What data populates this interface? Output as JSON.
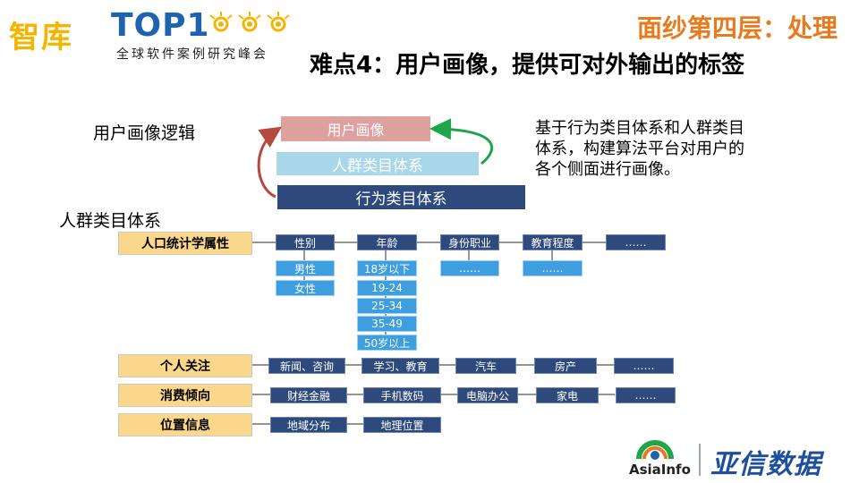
{
  "header": {
    "logo_zhiku": "智库",
    "logo_top": "TOP1",
    "logo_subtitle": "全球软件案例研究峰会",
    "section": "面纱第四层：处理",
    "title": "难点4：用户画像，提供可对外输出的标签"
  },
  "logic": {
    "label": "用户画像逻辑",
    "portrait": "用户画像",
    "crowd_system": "人群类目体系",
    "behavior_system": "行为类目体系",
    "description": "基于行为类目体系和人群类目体系，构建算法平台对用户的各个侧面进行画像。"
  },
  "crowd": {
    "label": "人群类目体系",
    "demographics": {
      "label": "人口统计学属性",
      "gender": {
        "label": "性别",
        "values": [
          "男性",
          "女性"
        ]
      },
      "age": {
        "label": "年龄",
        "values": [
          "18岁以下",
          "19-24",
          "25-34",
          "35-49",
          "50岁以上"
        ]
      },
      "occupation": {
        "label": "身份职业",
        "values": [
          "……"
        ]
      },
      "education": {
        "label": "教育程度",
        "values": [
          "……"
        ]
      },
      "more": "……"
    },
    "interests": {
      "label": "个人关注",
      "items": [
        "新闻、咨询",
        "学习、教育",
        "汽车",
        "房产",
        "……"
      ]
    },
    "consumption": {
      "label": "消费倾向",
      "items": [
        "财经金融",
        "手机数码",
        "电脑办公",
        "家电",
        "……"
      ]
    },
    "location": {
      "label": "位置信息",
      "items": [
        "地域分布",
        "地理位置"
      ]
    }
  },
  "footer": {
    "company_en": "AsiaInfo",
    "company_cn": "亚信数据"
  },
  "colors": {
    "accent_orange": "#e87a1e",
    "dark_box": "#2e4a7d",
    "light_box": "#3f9ee0",
    "category": "#fbd78b",
    "portrait": "#dda1a0",
    "crowd": "#a7d7e8"
  }
}
